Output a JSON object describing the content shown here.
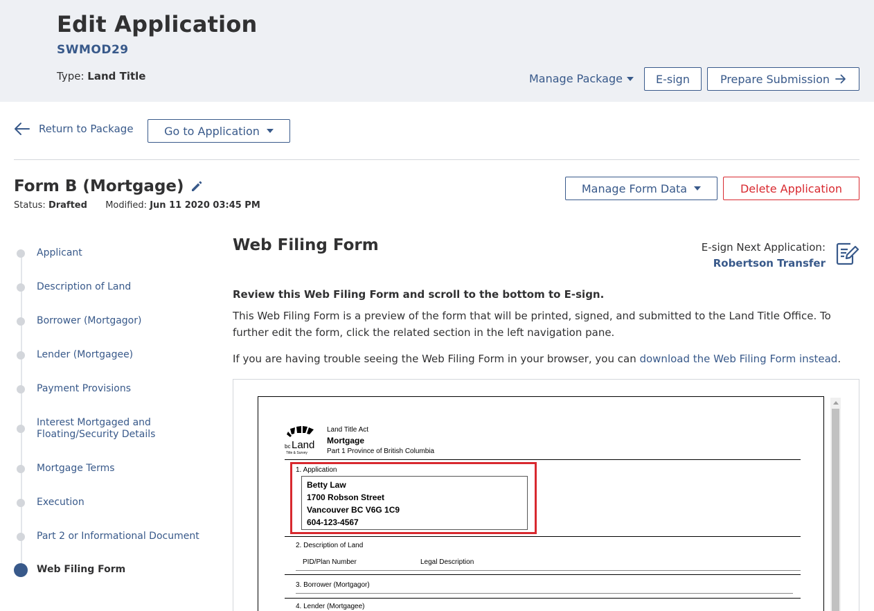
{
  "header": {
    "title": "Edit Application",
    "code": "SWMOD29",
    "type_label": "Type:",
    "type_value": "Land Title",
    "manage_package": "Manage Package",
    "esign": "E-sign",
    "prepare_submission": "Prepare Submission"
  },
  "nav_top": {
    "return_label": "Return to Package",
    "goto_label": "Go to Application"
  },
  "form": {
    "title": "Form B (Mortgage)",
    "status_label": "Status:",
    "status_value": "Drafted",
    "modified_label": "Modified:",
    "modified_value": "Jun 11 2020 03:45 PM",
    "manage_form_data": "Manage Form Data",
    "delete_application": "Delete Application"
  },
  "sidebar": {
    "items": [
      {
        "label": "Applicant",
        "active": false
      },
      {
        "label": "Description of Land",
        "active": false
      },
      {
        "label": "Borrower (Mortgagor)",
        "active": false
      },
      {
        "label": "Lender (Mortgagee)",
        "active": false
      },
      {
        "label": "Payment Provisions",
        "active": false
      },
      {
        "label": "Interest Mortgaged and Floating/Security Details",
        "active": false
      },
      {
        "label": "Mortgage Terms",
        "active": false
      },
      {
        "label": "Execution",
        "active": false
      },
      {
        "label": "Part 2 or Informational Document",
        "active": false
      },
      {
        "label": "Web Filing Form",
        "active": true
      }
    ]
  },
  "main": {
    "title": "Web Filing Form",
    "esign_next_label": "E-sign Next Application:",
    "esign_next_app": "Robertson Transfer",
    "review_heading": "Review this Web Filing Form and scroll to the bottom to E-sign.",
    "description": "This Web Filing Form is a preview of the form that will be printed, signed, and submitted to the Land Title Office. To further edit the form, click the related section in the left navigation pane.",
    "trouble_text": "If you are having trouble seeing the Web Filing Form in your browser, you can ",
    "trouble_link": "download the Web Filing Form instead",
    "trouble_end": "."
  },
  "document": {
    "logo_text_top": "bc",
    "logo_text_main": "Land",
    "logo_text_sub": "Title & Survey",
    "act": "Land Title Act",
    "form_name": "Mortgage",
    "part": "Part 1 Province of British Columbia",
    "section1": "1. Application",
    "applicant_lines": [
      "Betty Law",
      "1700 Robson Street",
      "Vancouver BC V6G 1C9",
      "604-123-4567"
    ],
    "section2": "2. Description of Land",
    "pid_label": "PID/Plan Number",
    "legal_label": "Legal Description",
    "section3": "3. Borrower (Mortgagor)",
    "section4": "4. Lender (Mortgagee)"
  },
  "colors": {
    "primary": "#38598a",
    "danger": "#d8292f",
    "header_bg": "#eef0f4",
    "text": "#313132"
  }
}
